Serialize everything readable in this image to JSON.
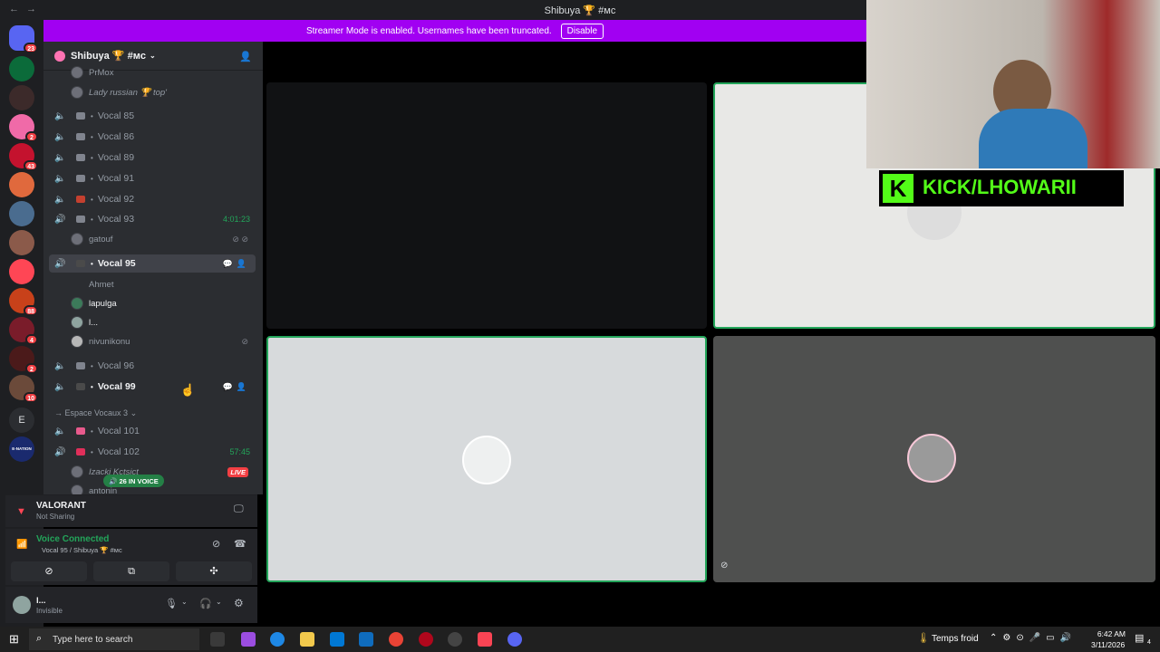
{
  "titlebar": {
    "title": "Shibuya 🏆 #ᴍᴄ"
  },
  "banner": {
    "message": "Streamer Mode is enabled. Usernames have been truncated.",
    "disable_label": "Disable"
  },
  "rail": {
    "badges": [
      "23",
      "2",
      "43",
      "2",
      "2",
      "88",
      "4",
      "2",
      "10"
    ],
    "letter_server": "E",
    "enation_label": "E-NATION"
  },
  "server": {
    "name": "Shibuya 🏆 #ᴍᴄ"
  },
  "channels": {
    "top_users": [
      "PrMox",
      "Lady russian 🏆 top'"
    ],
    "list": [
      {
        "name": "Vocal 85"
      },
      {
        "name": "Vocal 86"
      },
      {
        "name": "Vocal 89"
      },
      {
        "name": "Vocal 91"
      },
      {
        "name": "Vocal 92"
      },
      {
        "name": "Vocal 93",
        "time": "4:01:23",
        "user": "gatouf"
      },
      {
        "name": "Vocal 95",
        "users": [
          "Ahmet",
          "lapulga",
          "l...",
          "nivunikonu"
        ]
      },
      {
        "name": "Vocal 96"
      },
      {
        "name": "Vocal 99"
      }
    ],
    "category": "Espace Vocaux 3",
    "cat_list": [
      {
        "name": "Vocal 101"
      },
      {
        "name": "Vocal 102",
        "time": "57:45"
      }
    ],
    "live_user": "Izacki Kctsict",
    "live_label": "LIVE",
    "next_user": "antonin",
    "in_voice": "26 IN VOICE"
  },
  "activity": {
    "game": "VALORANT",
    "status": "Not Sharing"
  },
  "voice": {
    "status": "Voice Connected",
    "channel": "Vocal 95 / Shibuya 🏆 #ᴍᴄ"
  },
  "userpanel": {
    "name": "l...",
    "status": "Invisible"
  },
  "webcam": {
    "overlay_text": "KICK/LHOWARII"
  },
  "taskbar": {
    "search_placeholder": "Type here to search",
    "weather": "Temps froid",
    "time": "6:42 AM",
    "date": "3/11/2026",
    "notif_count": "4"
  },
  "colors": {
    "banner": "#a100f2",
    "voice_green": "#23a55a",
    "live_red": "#f23f43",
    "kick_green": "#53fc18"
  }
}
